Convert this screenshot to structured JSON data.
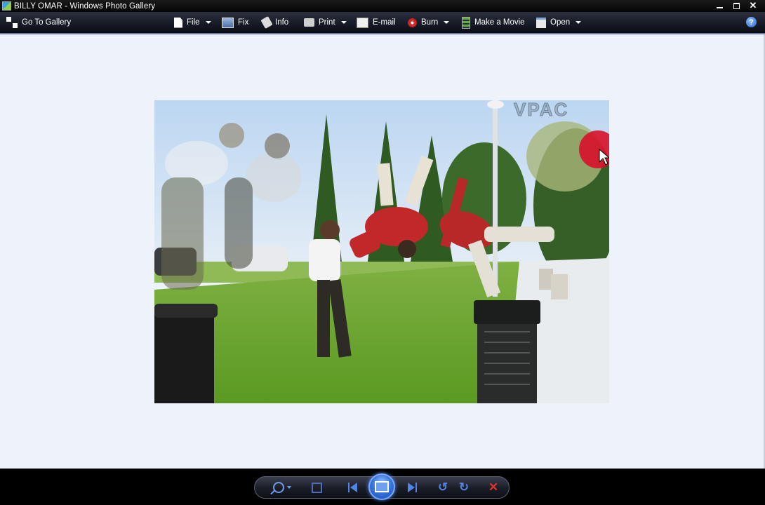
{
  "window": {
    "title": "BILLY OMAR - Windows Photo Gallery",
    "controls": {
      "close_glyph": "✕"
    }
  },
  "toolbar": {
    "items": [
      {
        "label": "Go To Gallery",
        "icon": "gallery-icon"
      },
      {
        "label": "File",
        "icon": "file-icon",
        "has_dropdown": true
      },
      {
        "label": "Fix",
        "icon": "fix-icon"
      },
      {
        "label": "Info",
        "icon": "info-tag-icon"
      },
      {
        "label": "Print",
        "icon": "printer-icon",
        "has_dropdown": true
      },
      {
        "label": "E-mail",
        "icon": "email-icon"
      },
      {
        "label": "Burn",
        "icon": "burn-disc-icon",
        "has_dropdown": true
      },
      {
        "label": "Make a Movie",
        "icon": "movie-icon"
      },
      {
        "label": "Open",
        "icon": "open-icon",
        "has_dropdown": true
      }
    ],
    "help_glyph": "?"
  },
  "photo": {
    "watermark": "VPAC",
    "subject": "photo"
  },
  "controlbar": {
    "buttons": [
      "zoom-icon",
      "actual-size-icon",
      "previous-icon",
      "slideshow-icon",
      "next-icon",
      "rotate-left-icon",
      "rotate-right-icon",
      "delete-icon"
    ],
    "rotate_left_glyph": "↺",
    "rotate_right_glyph": "↻",
    "delete_glyph": "✕"
  },
  "colors": {
    "viewer_background": "#eef2fa",
    "toolbar_accent": "#6e7aa0",
    "control_blue": "#4f84e6",
    "delete_red": "#e23030"
  }
}
